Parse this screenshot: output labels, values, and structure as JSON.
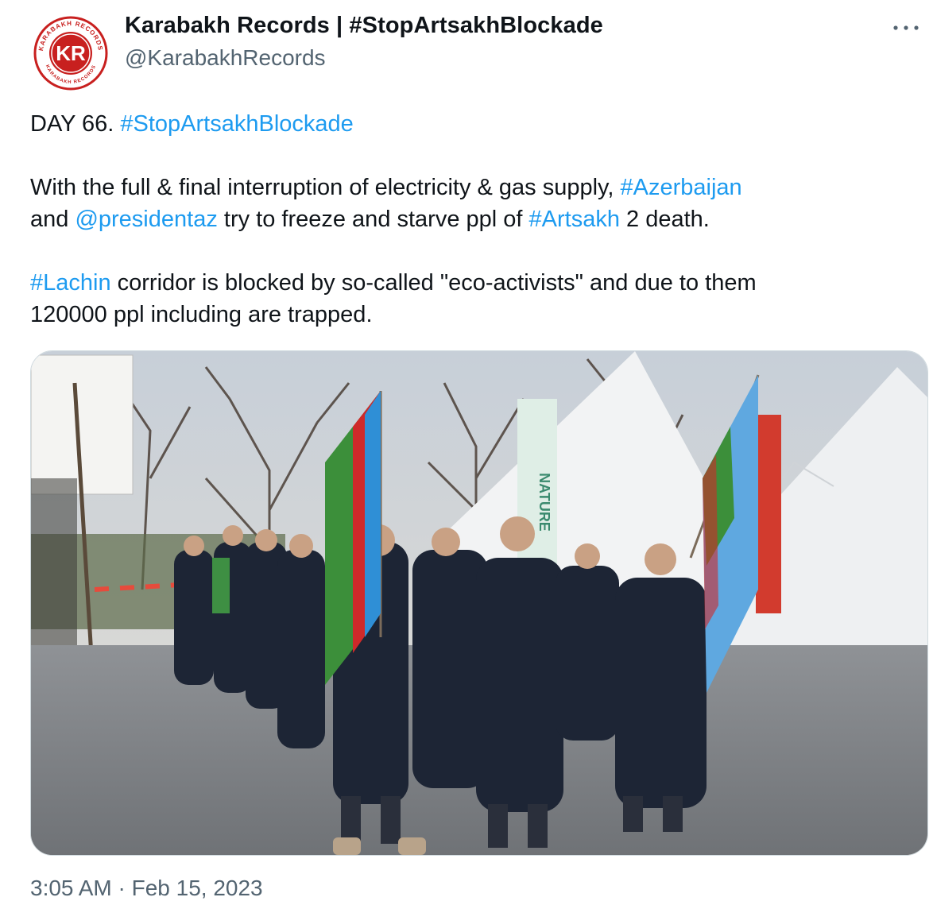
{
  "author": {
    "name": "Karabakh Records | #StopArtsakhBlockade",
    "handle": "@KarabakhRecords",
    "avatar_text": "KR",
    "avatar_ring_text": "KARABAKH RECORDS"
  },
  "tweet": {
    "line1": {
      "prefix": "DAY 66. ",
      "hashtag": "#StopArtsakhBlockade"
    },
    "line2": {
      "text": "With the full & final interruption of electricity & gas supply, ",
      "hashtag": "#Azerbaijan"
    },
    "line3": {
      "text_a": "and ",
      "mention": "@presidentaz",
      "text_b": " try to freeze and starve ppl of ",
      "hashtag": "#Artsakh",
      "text_c": " 2 death."
    },
    "line4": {
      "hashtag": "#Lachin",
      "text": " corridor is blocked by so-called \"eco-activists\" and due to them"
    },
    "line5": {
      "text": "120000 ppl including are trapped."
    }
  },
  "media": {
    "description": "photo",
    "banner_text": "NATURE"
  },
  "timestamp": "3:05 AM · Feb 15, 2023",
  "colors": {
    "link": "#1d9bf0",
    "text": "#0f1419",
    "secondary": "#536471",
    "brand_red": "#c8201f"
  },
  "icons": {
    "more": "more-horizontal-icon"
  }
}
